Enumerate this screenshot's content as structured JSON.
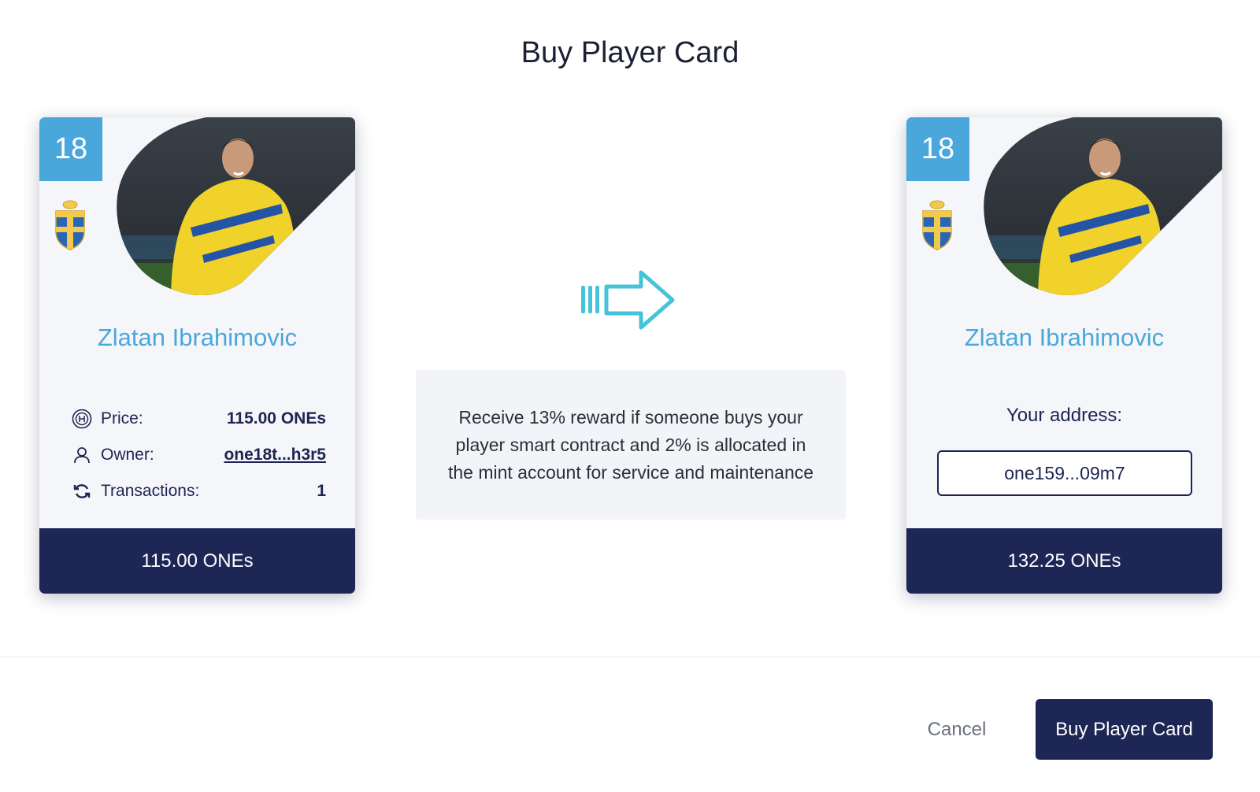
{
  "modal": {
    "title": "Buy Player Card",
    "info_text": "Receive 13% reward if someone buys your player smart contract and 2% is allocated in the mint account for service and maintenance",
    "cancel_label": "Cancel",
    "buy_label": "Buy Player Card"
  },
  "left_card": {
    "number": "18",
    "player_name": "Zlatan Ibrahimovic",
    "price_label": "Price:",
    "price_value": "115.00 ONEs",
    "owner_label": "Owner:",
    "owner_value": "one18t...h3r5",
    "transactions_label": "Transactions:",
    "transactions_value": "1",
    "footer_price": "115.00 ONEs"
  },
  "right_card": {
    "number": "18",
    "player_name": "Zlatan Ibrahimovic",
    "address_label": "Your address:",
    "address_value": "one159...09m7",
    "footer_price": "132.25 ONEs"
  },
  "colors": {
    "accent_blue": "#4aa7dc",
    "navy": "#1d2654",
    "arrow_cyan": "#45c3d8"
  },
  "icons": [
    "coin-icon",
    "user-icon",
    "refresh-icon",
    "arrow-right-icon",
    "sweden-crest-icon"
  ]
}
